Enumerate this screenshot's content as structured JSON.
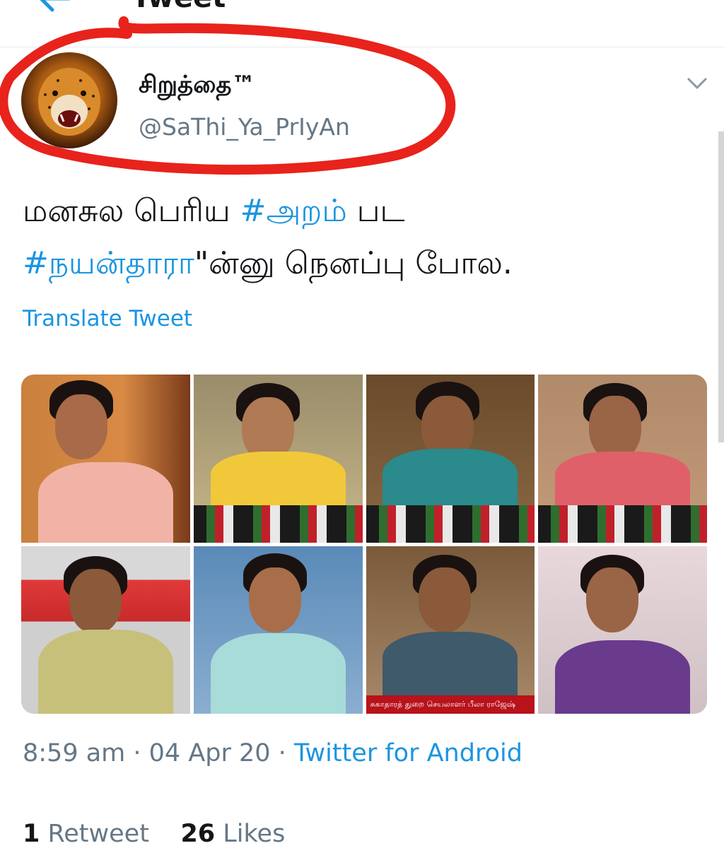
{
  "topbar": {
    "title": "Tweet"
  },
  "user": {
    "display_name": "சிறுத்தை™",
    "handle": "@SaThi_Ya_PrIyAn"
  },
  "tweet": {
    "line1_text": "மனசுல பெரிய ",
    "line1_hashtag": "#அறம்",
    "line1_tail": " பட",
    "line2_hashtag": "#நயன்தாரா",
    "line2_tail": "\"ன்னு நெனப்பு போல.",
    "translate_label": "Translate Tweet"
  },
  "photos": {
    "caption_strip_text": "சுகாதாரத் துறை செயலாளர் பீலா ராஜேஷ்"
  },
  "meta": {
    "time": "8:59 am",
    "separator": " · ",
    "date": "04 Apr 20",
    "source": "Twitter for Android"
  },
  "stats": {
    "retweets_count": "1",
    "retweets_label": "Retweet",
    "likes_count": "26",
    "likes_label": "Likes"
  },
  "colors": {
    "link": "#1b95e0",
    "secondary_text": "#657786",
    "annotation": "#e8231b"
  },
  "icons": [
    "back-arrow-icon",
    "chevron-down-icon"
  ]
}
